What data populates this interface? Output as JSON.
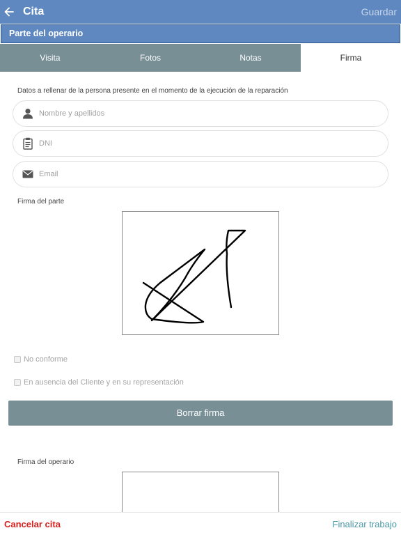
{
  "header": {
    "title": "Cita",
    "save_label": "Guardar"
  },
  "section_title": "Parte del operario",
  "tabs": [
    {
      "label": "Visita",
      "active": false
    },
    {
      "label": "Fotos",
      "active": false
    },
    {
      "label": "Notas",
      "active": false
    },
    {
      "label": "Firma",
      "active": true
    }
  ],
  "form": {
    "intro": "Datos a rellenar de la persona presente en el momento de la ejecución de la reparación",
    "name_placeholder": "Nombre y apellidos",
    "name_value": "",
    "dni_placeholder": "DNI",
    "dni_value": "",
    "email_placeholder": "Email",
    "email_value": ""
  },
  "signature_part_label": "Firma del parte",
  "checkboxes": {
    "no_conforme": {
      "label": "No conforme",
      "checked": false
    },
    "ausencia": {
      "label": "En ausencia del Cliente y en su representación",
      "checked": false
    }
  },
  "clear_signature_label": "Borrar firma",
  "signature_operator_label": "Firma del operario",
  "footer": {
    "cancel_label": "Cancelar cita",
    "finish_label": "Finalizar trabajo"
  },
  "colors": {
    "appbar": "#5e88bf",
    "tab_inactive": "#778f95",
    "cancel": "#d82020",
    "finish": "#4a9aa6"
  },
  "icons": {
    "back": "arrow-left-icon",
    "name": "person-icon",
    "dni": "clipboard-icon",
    "email": "envelope-icon"
  }
}
